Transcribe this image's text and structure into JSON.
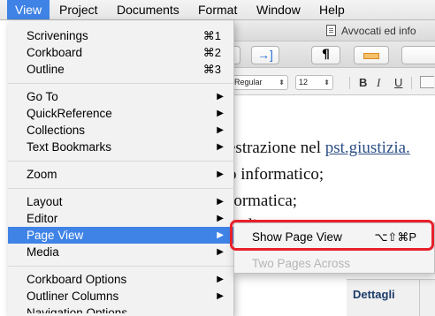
{
  "menubar": {
    "items": [
      {
        "label": "View",
        "active": true
      },
      {
        "label": "Project"
      },
      {
        "label": "Documents"
      },
      {
        "label": "Format"
      },
      {
        "label": "Window"
      },
      {
        "label": "Help"
      }
    ],
    "accent_color": "#3f83e6"
  },
  "window": {
    "title": "Avvocati ed info",
    "toolbar": {
      "paragraph_glyph": "¶",
      "page_glyph": "→]"
    },
    "formatbar": {
      "font_style": "Regular",
      "font_size": "12",
      "bold": "B",
      "italic": "I",
      "underline": "U"
    },
    "document_lines": [
      {
        "text": "estrazione nel ",
        "link": "pst.giustizia."
      },
      {
        "text": "o informatico;"
      },
      {
        "text": "formatica;"
      },
      {
        "text": "diyyyy"
      }
    ],
    "dettagli_label": "Dettagli"
  },
  "view_menu": {
    "items": [
      {
        "label": "Scrivenings",
        "shortcut": "⌘1"
      },
      {
        "label": "Corkboard",
        "shortcut": "⌘2"
      },
      {
        "label": "Outline",
        "shortcut": "⌘3"
      },
      {
        "label": "Go To",
        "submenu": true
      },
      {
        "label": "QuickReference",
        "submenu": true
      },
      {
        "label": "Collections",
        "submenu": true
      },
      {
        "label": "Text Bookmarks",
        "submenu": true
      },
      {
        "label": "Zoom",
        "submenu": true
      },
      {
        "label": "Layout",
        "submenu": true
      },
      {
        "label": "Editor",
        "submenu": true
      },
      {
        "label": "Page View",
        "submenu": true,
        "highlighted": true
      },
      {
        "label": "Media",
        "submenu": true
      },
      {
        "label": "Corkboard Options",
        "submenu": true
      },
      {
        "label": "Outliner Columns",
        "submenu": true
      },
      {
        "label": "Navigation Options",
        "submenu": true
      }
    ],
    "arrow_glyph": "▶"
  },
  "page_view_submenu": {
    "items": [
      {
        "label": "Show Page View",
        "shortcut": "⌥⇧⌘P",
        "enabled": true
      },
      {
        "label": "Two Pages Across",
        "enabled": false
      }
    ],
    "highlight_color": "#e8202a"
  }
}
